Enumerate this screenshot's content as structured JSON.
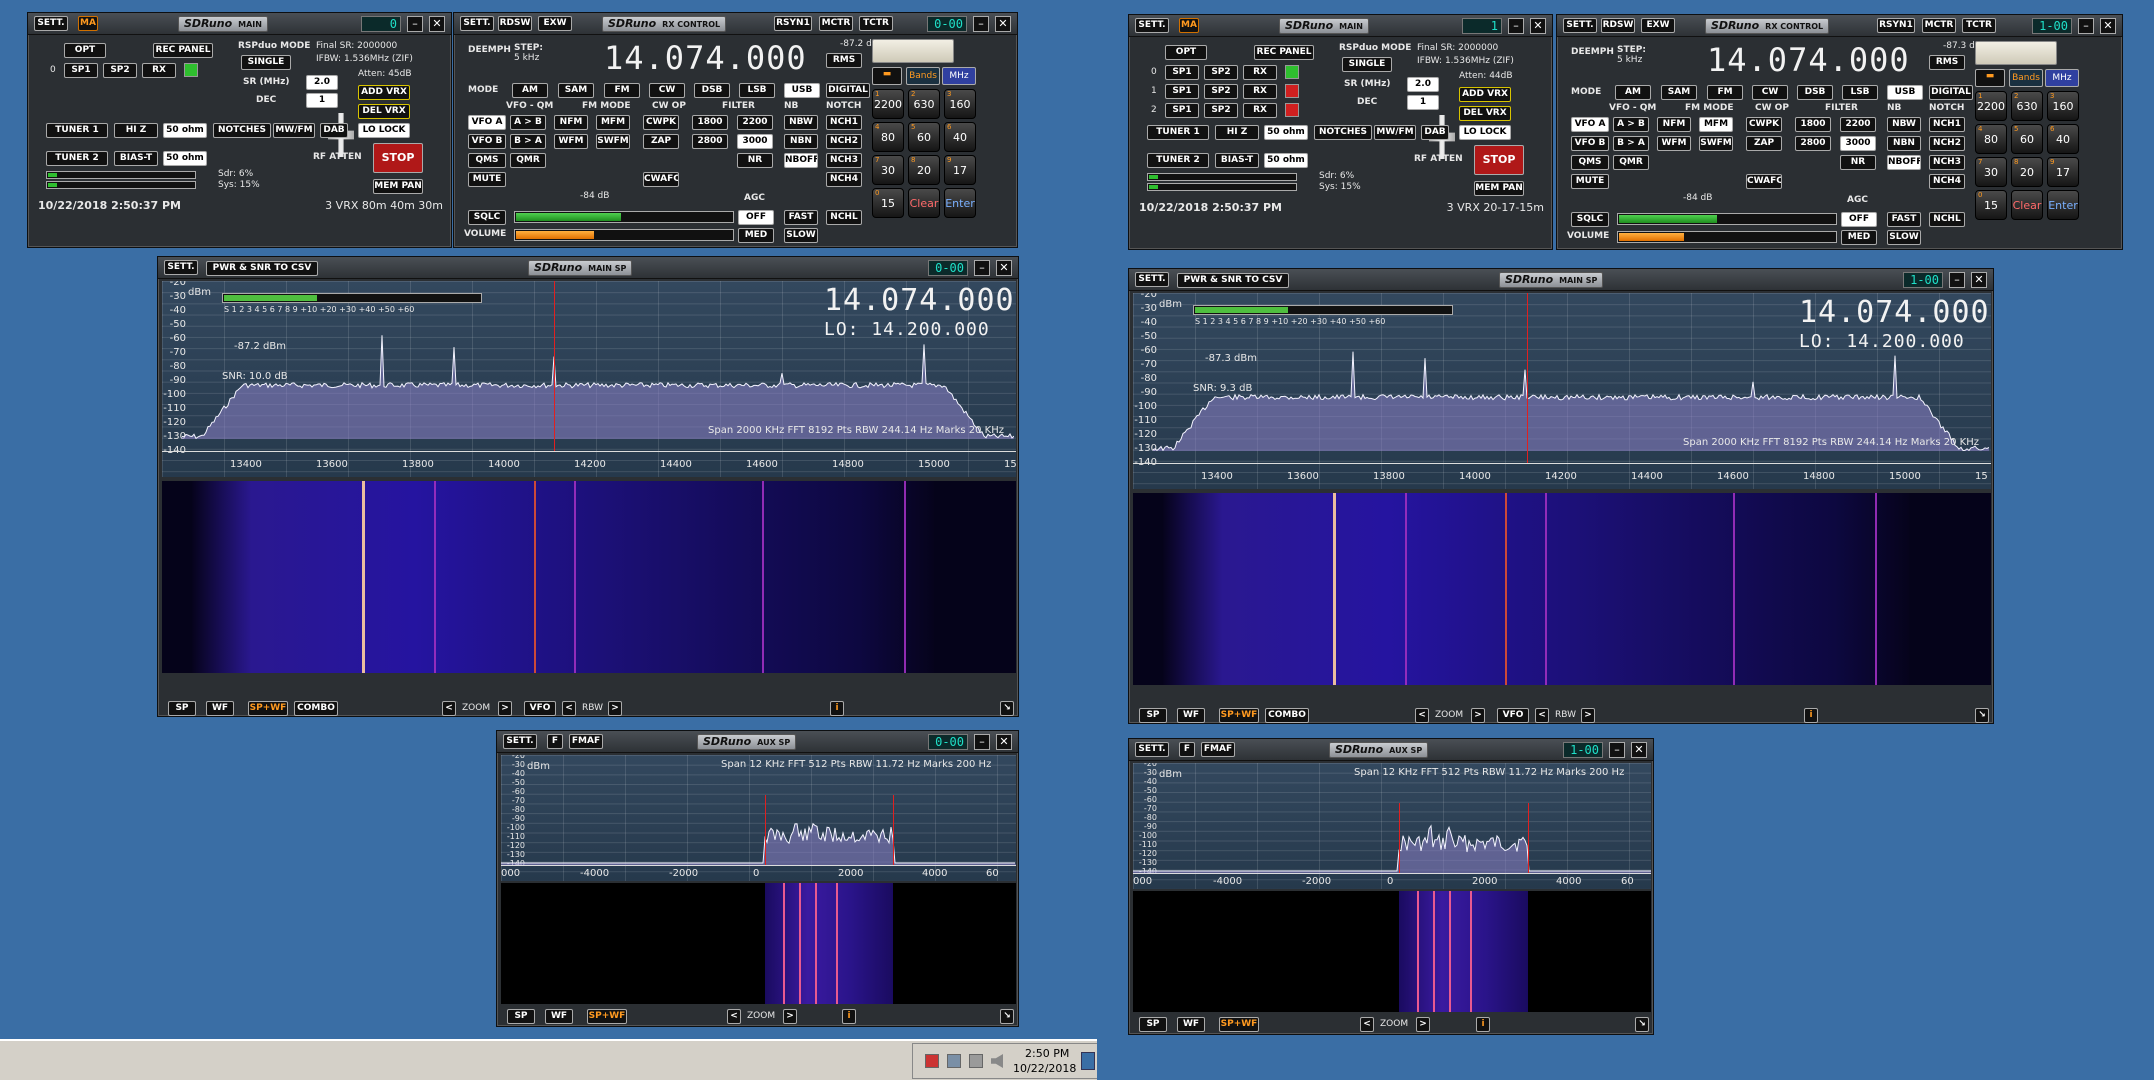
{
  "left": {
    "main": {
      "logo": "SDRuno",
      "title": "MAIN",
      "sett": "SETT.",
      "ma": "MA",
      "lcd": "0",
      "opt": "OPT",
      "rec_panel": "REC PANEL",
      "rsp_mode_label": "RSPduo MODE",
      "rsp_mode": "SINGLE",
      "final_sr": "Final SR: 2000000",
      "ifbw": "IFBW: 1.536MHz (ZIF)",
      "atten": "Atten: 45dB",
      "sp1": "SP1",
      "sp2": "SP2",
      "rx": "RX",
      "row_nums": [
        "0"
      ],
      "sr_label": "SR (MHz)",
      "sr": "2.0",
      "dec_label": "DEC",
      "dec": "1",
      "add_vrx": "ADD VRX",
      "del_vrx": "DEL VRX",
      "lo_lock": "LO LOCK",
      "tuner1": "TUNER 1",
      "hiz": "HI Z",
      "ohm1": "50 ohm",
      "tuner2": "TUNER 2",
      "biast": "BIAS-T",
      "ohm2": "50 ohm",
      "notches": "NOTCHES",
      "mwfm": "MW/FM",
      "dab": "DAB",
      "rf_atten": "RF ATTEN",
      "stop": "STOP",
      "mem_pan": "MEM PAN",
      "sdr": "Sdr: 6%",
      "sys": "Sys: 15%",
      "datetime": "10/22/2018 2:50:37 PM",
      "vrx_info": "3 VRX 80m 40m 30m"
    },
    "rx": {
      "logo": "SDRuno",
      "title": "RX CONTROL",
      "sett": "SETT.",
      "rdsw": "RDSW",
      "exw": "EXW",
      "rsyn1": "RSYN1",
      "mctr": "MCTR",
      "tctr": "TCTR",
      "lcd": "0-00",
      "deemph": "DEEMPH",
      "step": "STEP:",
      "step_val": "5 kHz",
      "freq": "14.074.000",
      "dbm": "-87.2 dBm",
      "rms": "RMS",
      "mode": "MODE",
      "modes": [
        "AM",
        "SAM",
        "FM",
        "CW",
        "DSB",
        "LSB",
        "USB",
        "DIGITAL"
      ],
      "vfo_qm": "VFO - QM",
      "fm_mode": "FM MODE",
      "cw_op": "CW OP",
      "filter": "FILTER",
      "nb": "NB",
      "notch": "NOTCH",
      "vfo_a": "VFO A",
      "a_b": "A > B",
      "nfm": "NFM",
      "mfm": "MFM",
      "cwpk": "CWPK",
      "f1800": "1800",
      "f2200": "2200",
      "nbw": "NBW",
      "nch1": "NCH1",
      "vfo_b": "VFO B",
      "b_a": "B > A",
      "wfm": "WFM",
      "swfm": "SWFM",
      "zap": "ZAP",
      "f2800": "2800",
      "f3000": "3000",
      "nbn": "NBN",
      "nch2": "NCH2",
      "qms": "QMS",
      "qmr": "QMR",
      "nr": "NR",
      "nboff": "NBOFF",
      "nch3": "NCH3",
      "mute": "MUTE",
      "cwafc": "CWAFC",
      "nch4": "NCH4",
      "sqlc": "SQLC",
      "sq_db": "-84 dB",
      "agc": "AGC",
      "off": "OFF",
      "fast": "FAST",
      "nchl": "NCHL",
      "volume": "VOLUME",
      "med": "MED",
      "slow": "SLOW",
      "bands": "Bands",
      "mhz": "MHz",
      "keys": [
        "2200",
        "630",
        "160",
        "80",
        "60",
        "40",
        "30",
        "20",
        "17",
        "15"
      ],
      "clear": "Clear",
      "enter": "Enter",
      "squelch_fill": 0.48,
      "volume_fill": 0.36
    },
    "sp": {
      "logo": "SDRuno",
      "title": "MAIN SP",
      "sett": "SETT.",
      "csv": "PWR & SNR TO CSV",
      "lcd": "0-00",
      "dbm_unit": "dBm",
      "freq": "14.074.000",
      "lo": "LO:  14.200.000",
      "level": "-87.2 dBm",
      "snr": "SNR: 10.0 dB",
      "info": "Span 2000 KHz  FFT 8192 Pts  RBW 244.14 Hz  Marks 20 KHz",
      "yticks": [
        "-20",
        "-30",
        "-40",
        "-50",
        "-60",
        "-70",
        "-80",
        "-90",
        "-100",
        "-110",
        "-120",
        "-130",
        "-140"
      ],
      "xticks": [
        "13400",
        "13600",
        "13800",
        "14000",
        "14200",
        "14400",
        "14600",
        "14800",
        "15000",
        "15"
      ],
      "smeter": "S  1  2  3  4  5  6  7  8  9   +10 +20 +30 +40 +50 +60",
      "smeter_fill": 0.36,
      "btn_sp": "SP",
      "btn_wf": "WF",
      "btn_spwf": "SP+WF",
      "btn_combo": "COMBO",
      "zoom": "ZOOM",
      "vfo": "VFO",
      "rbw": "RBW",
      "info_btn": "i"
    },
    "aux": {
      "logo": "SDRuno",
      "title": "AUX SP",
      "sett": "SETT.",
      "f": "F",
      "fmaf": "FMAF",
      "lcd": "0-00",
      "dbm_unit": "dBm",
      "info": "Span 12 KHz  FFT 512 Pts  RBW 11.72 Hz  Marks 200 Hz",
      "yticks": [
        "-20",
        "-30",
        "-40",
        "-50",
        "-60",
        "-70",
        "-80",
        "-90",
        "-100",
        "-110",
        "-120",
        "-130",
        "-140"
      ],
      "xticks": [
        "000",
        "-4000",
        "-2000",
        "0",
        "2000",
        "4000",
        "60"
      ],
      "btn_sp": "SP",
      "btn_wf": "WF",
      "btn_spwf": "SP+WF",
      "zoom": "ZOOM",
      "info_btn": "i"
    }
  },
  "right": {
    "main": {
      "logo": "SDRuno",
      "title": "MAIN",
      "sett": "SETT.",
      "ma": "MA",
      "lcd": "1",
      "opt": "OPT",
      "rec_panel": "REC PANEL",
      "rsp_mode_label": "RSPduo MODE",
      "rsp_mode": "SINGLE",
      "final_sr": "Final SR: 2000000",
      "ifbw": "IFBW: 1.536MHz (ZIF)",
      "atten": "Atten: 44dB",
      "sp1": "SP1",
      "sp2": "SP2",
      "rx": "RX",
      "row_nums": [
        "0",
        "1",
        "2"
      ],
      "sr_label": "SR (MHz)",
      "sr": "2.0",
      "dec_label": "DEC",
      "dec": "1",
      "add_vrx": "ADD VRX",
      "del_vrx": "DEL VRX",
      "lo_lock": "LO LOCK",
      "tuner1": "TUNER 1",
      "hiz": "HI Z",
      "ohm1": "50 ohm",
      "tuner2": "TUNER 2",
      "biast": "BIAS-T",
      "ohm2": "50 ohm",
      "notches": "NOTCHES",
      "mwfm": "MW/FM",
      "dab": "DAB",
      "rf_atten": "RF ATTEN",
      "stop": "STOP",
      "mem_pan": "MEM PAN",
      "sdr": "Sdr: 6%",
      "sys": "Sys: 15%",
      "datetime": "10/22/2018 2:50:37 PM",
      "vrx_info": "3 VRX 20-17-15m"
    },
    "rx": {
      "logo": "SDRuno",
      "title": "RX CONTROL",
      "sett": "SETT.",
      "rdsw": "RDSW",
      "exw": "EXW",
      "rsyn1": "RSYN1",
      "mctr": "MCTR",
      "tctr": "TCTR",
      "lcd": "1-00",
      "deemph": "DEEMPH",
      "step": "STEP:",
      "step_val": "5 kHz",
      "freq": "14.074.000",
      "dbm": "-87.3 dBm",
      "rms": "RMS",
      "mode": "MODE",
      "modes": [
        "AM",
        "SAM",
        "FM",
        "CW",
        "DSB",
        "LSB",
        "USB",
        "DIGITAL"
      ],
      "vfo_qm": "VFO - QM",
      "fm_mode": "FM MODE",
      "cw_op": "CW OP",
      "filter": "FILTER",
      "nb": "NB",
      "notch": "NOTCH",
      "vfo_a": "VFO A",
      "a_b": "A > B",
      "nfm": "NFM",
      "mfm": "MFM",
      "cwpk": "CWPK",
      "f1800": "1800",
      "f2200": "2200",
      "nbw": "NBW",
      "nch1": "NCH1",
      "vfo_b": "VFO B",
      "b_a": "B > A",
      "wfm": "WFM",
      "swfm": "SWFM",
      "zap": "ZAP",
      "f2800": "2800",
      "f3000": "3000",
      "nbn": "NBN",
      "nch2": "NCH2",
      "qms": "QMS",
      "qmr": "QMR",
      "nr": "NR",
      "nboff": "NBOFF",
      "nch3": "NCH3",
      "mute": "MUTE",
      "cwafc": "CWAFC",
      "nch4": "NCH4",
      "sqlc": "SQLC",
      "sq_db": "-84 dB",
      "agc": "AGC",
      "off": "OFF",
      "fast": "FAST",
      "nchl": "NCHL",
      "volume": "VOLUME",
      "med": "MED",
      "slow": "SLOW",
      "bands": "Bands",
      "mhz": "MHz",
      "keys": [
        "2200",
        "630",
        "160",
        "80",
        "60",
        "40",
        "30",
        "20",
        "17",
        "15"
      ],
      "clear": "Clear",
      "enter": "Enter",
      "squelch_fill": 0.45,
      "volume_fill": 0.3
    },
    "sp": {
      "logo": "SDRuno",
      "title": "MAIN SP",
      "sett": "SETT.",
      "csv": "PWR & SNR TO CSV",
      "lcd": "1-00",
      "dbm_unit": "dBm",
      "freq": "14.074.000",
      "lo": "LO:  14.200.000",
      "level": "-87.3 dBm",
      "snr": "SNR: 9.3 dB",
      "info": "Span 2000 KHz  FFT 8192 Pts  RBW 244.14 Hz  Marks 20 KHz",
      "yticks": [
        "-20",
        "-30",
        "-40",
        "-50",
        "-60",
        "-70",
        "-80",
        "-90",
        "-100",
        "-110",
        "-120",
        "-130",
        "-140"
      ],
      "xticks": [
        "13400",
        "13600",
        "13800",
        "14000",
        "14200",
        "14400",
        "14600",
        "14800",
        "15000",
        "15"
      ],
      "smeter": "S  1  2  3  4  5  6  7  8  9   +10 +20 +30 +40 +50 +60",
      "smeter_fill": 0.36,
      "btn_sp": "SP",
      "btn_wf": "WF",
      "btn_spwf": "SP+WF",
      "btn_combo": "COMBO",
      "zoom": "ZOOM",
      "vfo": "VFO",
      "rbw": "RBW",
      "info_btn": "i"
    },
    "aux": {
      "logo": "SDRuno",
      "title": "AUX SP",
      "sett": "SETT.",
      "f": "F",
      "fmaf": "FMAF",
      "lcd": "1-00",
      "dbm_unit": "dBm",
      "info": "Span 12 KHz  FFT 512 Pts  RBW 11.72 Hz  Marks 200 Hz",
      "yticks": [
        "-20",
        "-30",
        "-40",
        "-50",
        "-60",
        "-70",
        "-80",
        "-90",
        "-100",
        "-110",
        "-120",
        "-130",
        "-140"
      ],
      "xticks": [
        "000",
        "-4000",
        "-2000",
        "0",
        "2000",
        "4000",
        "60"
      ],
      "btn_sp": "SP",
      "btn_wf": "WF",
      "btn_spwf": "SP+WF",
      "zoom": "ZOOM",
      "info_btn": "i"
    }
  },
  "taskbar": {
    "time": "2:50 PM",
    "date": "10/22/2018"
  },
  "colors": {
    "accent": "#ff9a20",
    "meter_green": "#2fbf2f",
    "stop_red": "#b01818",
    "marker_red": "#e02020",
    "desktop": "#3a6ea5"
  }
}
